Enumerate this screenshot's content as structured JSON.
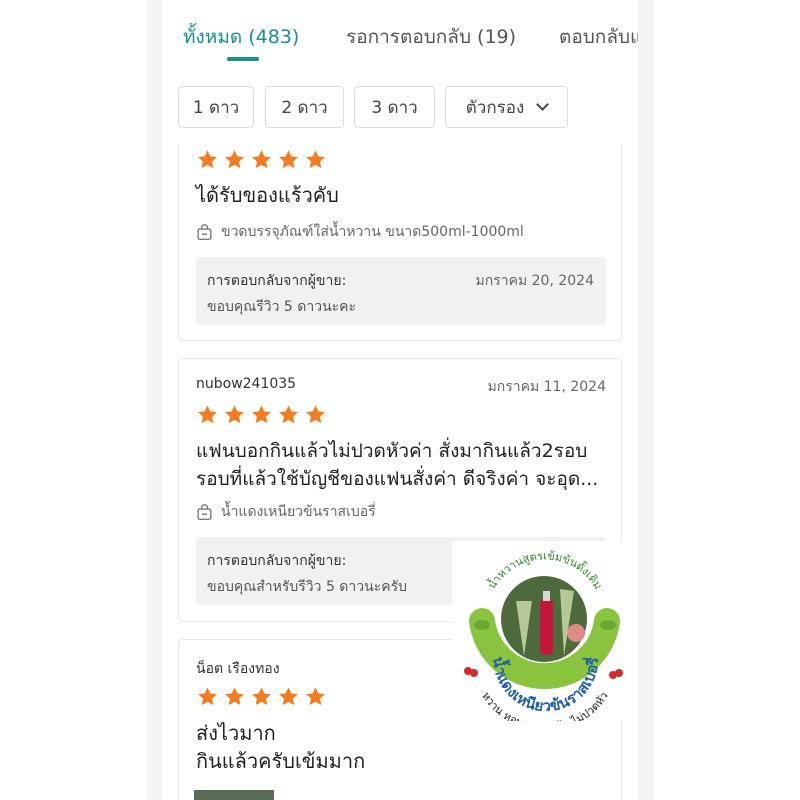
{
  "tabs": [
    {
      "label": "ทั้งหมด (483)",
      "active": true
    },
    {
      "label": "รอการตอบกลับ (19)",
      "active": false
    },
    {
      "label": "ตอบกลับแ",
      "active": false
    }
  ],
  "filters": {
    "one_star": "1 ดาว",
    "two_star": "2 ดาว",
    "three_star": "3 ดาว",
    "filter_label": "ตัวกรอง"
  },
  "reviews": [
    {
      "rating": 5,
      "text": "ได้รับของแร้วคับ",
      "variant": "ขวดบรรจุภัณฑ์ใส่น้ำหวาน ขนาด500ml-1000ml",
      "reply": {
        "title": "การตอบกลับจากผู้ขาย:",
        "date": "มกราคม 20, 2024",
        "text": "ขอบคุณรีวิว 5 ดาวนะคะ"
      }
    },
    {
      "user": "nubow241035",
      "date": "มกราคม 11, 2024",
      "rating": 5,
      "text_line1": "แฟนบอกกินแล้วไม่ปวดหัวค่า สั่งมากินแล้ว2รอบ",
      "text_line2": "รอบที่แล้วใช้บัญชีของแฟนสั่งค่า ดีจริงค่า จะอุด...",
      "variant": "น้ำแดงเหนียวข้นราสเบอรี่",
      "reply": {
        "title": "การตอบกลับจากผู้ขาย:",
        "text": "ขอบคุณสำหรับรีวิว 5 ดาวนะครับ"
      }
    },
    {
      "user": "น็อต เรืองทอง",
      "rating": 5,
      "text_line1": "ส่งไวมาก",
      "text_line2": "กินแล้วครับเข้มมาก"
    }
  ],
  "promo": {
    "arc_top": "น้ำหวานสูตรเข้มข้นดั้งเดิม",
    "title": "น้ำแดงเหนียวข้นราสเบอรี่",
    "arc_bottom": "หวาน หอม เหนียวข้น ไม่ปวดหัว"
  },
  "colors": {
    "accent": "#16918f",
    "star": "#f57c1f",
    "promo_green": "#8ac43f"
  }
}
